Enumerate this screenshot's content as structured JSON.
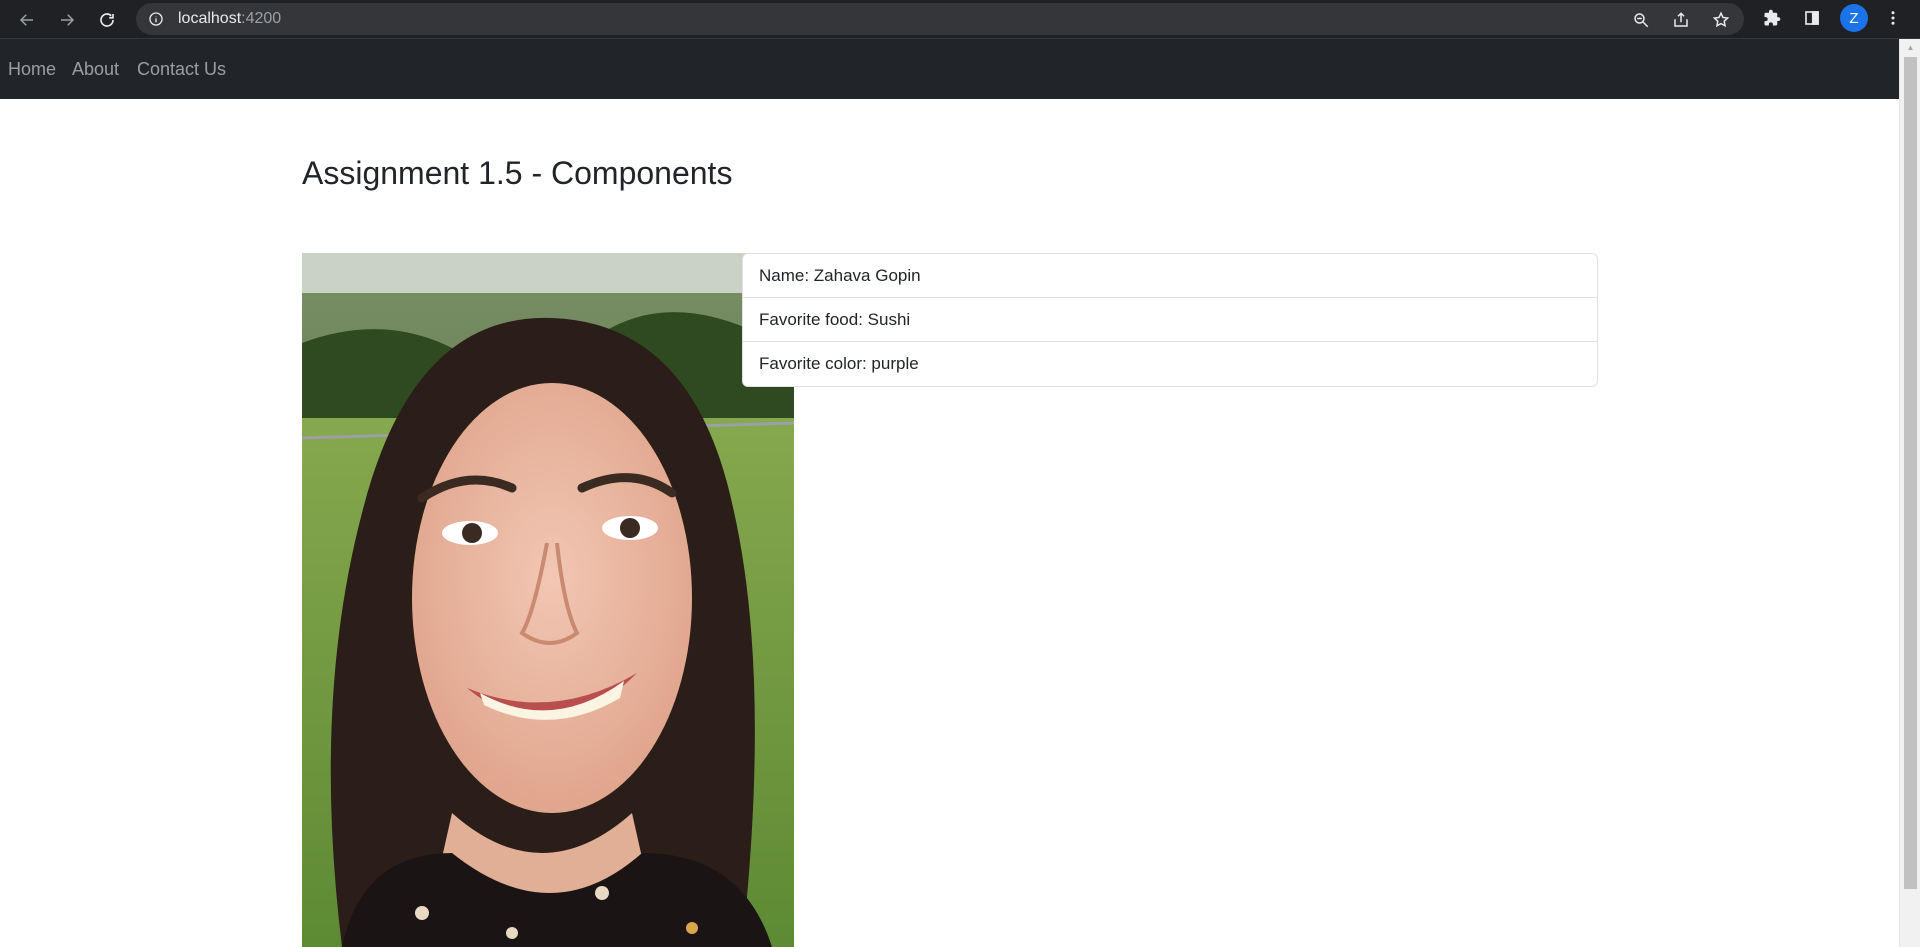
{
  "browser": {
    "url_host": "localhost",
    "url_port": ":4200",
    "profile_initial": "Z"
  },
  "navbar": {
    "links": [
      "Home",
      "About",
      "Contact Us"
    ]
  },
  "page": {
    "title": "Assignment 1.5 - Components"
  },
  "profile": {
    "items": [
      "Name: Zahava Gopin",
      "Favorite food: Sushi",
      "Favorite color: purple"
    ]
  },
  "colors": {
    "navbar_bg": "#212529",
    "chrome_bg": "#202124",
    "avatar_bg": "#1a73e8"
  }
}
